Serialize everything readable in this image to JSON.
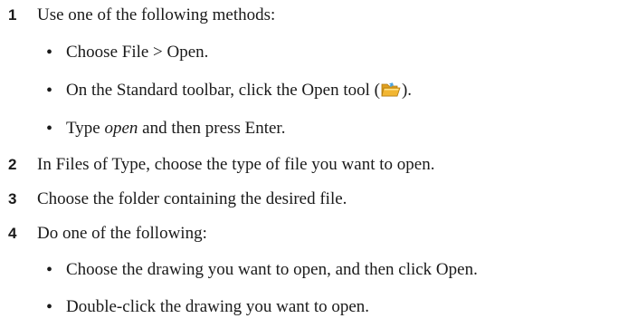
{
  "steps": [
    {
      "number": "1",
      "text": "Use one of the following methods:",
      "bullets": [
        {
          "text": "Choose File > Open."
        },
        {
          "before": "On the Standard toolbar, click the Open tool (",
          "icon": "open-folder-icon",
          "after": ")."
        },
        {
          "italic": "open",
          "after": " and then press Enter.",
          "before": "Type "
        }
      ]
    },
    {
      "number": "2",
      "text": "In Files of Type, choose the type of file you want to open."
    },
    {
      "number": "3",
      "text": "Choose the folder containing the desired file."
    },
    {
      "number": "4",
      "text": "Do one of the following:",
      "bullets": [
        {
          "text": "Choose the drawing you want to open, and then click Open."
        },
        {
          "text": "Double-click the drawing you want to open."
        }
      ]
    }
  ],
  "bullet_glyph": "•",
  "colors": {
    "text": "#1a1a1a",
    "folder_body": "#f2b632",
    "folder_highlight": "#fde28a",
    "folder_accent": "#4aa3df"
  }
}
